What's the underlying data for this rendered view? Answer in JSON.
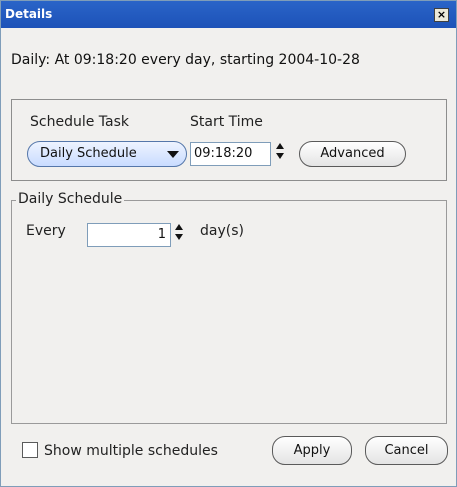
{
  "window": {
    "title": "Details",
    "close_glyph": "×"
  },
  "summary": "Daily: At 09:18:20 every day, starting 2004-10-28",
  "schedule_task": {
    "label": "Schedule Task",
    "selected": "Daily Schedule",
    "arrow_icon": "chevron-down-icon"
  },
  "start_time": {
    "label": "Start Time",
    "value": "09:18:20"
  },
  "advanced_button": "Advanced",
  "daily_schedule": {
    "legend": "Daily Schedule",
    "every_label": "Every",
    "every_value": "1",
    "unit_label": "day(s)"
  },
  "footer": {
    "checkbox_label": "Show multiple schedules",
    "checkbox_checked": false,
    "apply": "Apply",
    "cancel": "Cancel"
  },
  "colors": {
    "titlebar": "#1d52b8",
    "window_bg": "#f1f0ee",
    "combo_bg": "#c9dcff"
  }
}
